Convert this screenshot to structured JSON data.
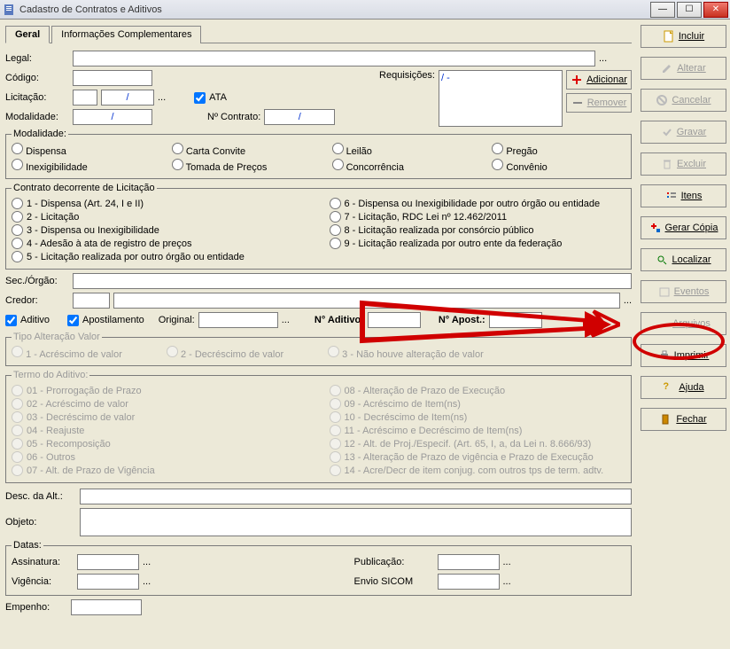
{
  "window": {
    "title": "Cadastro de Contratos e Aditivos"
  },
  "tabs": {
    "geral": "Geral",
    "info": "Informações Complementares"
  },
  "fields": {
    "legal": "Legal:",
    "codigo": "Código:",
    "licitacao": "Licitação:",
    "modalidade_lbl": "Modalidade:",
    "requisicoes": "Requisições:",
    "ata": "ATA",
    "n_contrato": "Nº Contrato:",
    "licitacao_val": "/",
    "modal_val": "/",
    "contrato_val": "/",
    "req_val": "/    -",
    "sec_orgao": "Sec./Órgão:",
    "credor": "Credor:",
    "aditivo": "Aditivo",
    "apostilamento": "Apostilamento",
    "original": "Original:",
    "n_aditivo": "N° Aditivo:",
    "n_apost": "N° Apost.:",
    "desc_alt": "Desc. da Alt.:",
    "objeto": "Objeto:",
    "datas": "Datas:",
    "assinatura": "Assinatura:",
    "vigencia": "Vigência:",
    "publicacao": "Publicação:",
    "envio_sicom": "Envio SICOM",
    "empenho": "Empenho:"
  },
  "modalidade": {
    "legend": "Modalidade:",
    "opts": [
      "Dispensa",
      "Inexigibilidade",
      "Carta Convite",
      "Tomada de Preços",
      "Leilão",
      "Concorrência",
      "Pregão",
      "Convênio"
    ]
  },
  "contrato_lic": {
    "legend": "Contrato decorrente de Licitação",
    "left": [
      "1 - Dispensa  (Art. 24, I e II)",
      "2 - Licitação",
      "3 - Dispensa ou Inexigibilidade",
      "4 - Adesão à ata de registro de preços",
      "5 - Licitação realizada por outro órgão ou entidade"
    ],
    "right": [
      "6 - Dispensa ou Inexigibilidade por outro órgão ou entidade",
      "7 - Licitação, RDC  Lei nº 12.462/2011",
      "8 - Licitação realizada por consórcio público",
      "9 - Licitação realizada por outro ente da federação"
    ]
  },
  "tipo_alt": {
    "legend": "Tipo Alteração Valor",
    "opts": [
      "1 - Acréscimo de valor",
      "2 - Decréscimo de valor",
      "3 - Não houve alteração de valor"
    ]
  },
  "termo": {
    "legend": "Termo do Aditivo:",
    "left": [
      "01 - Prorrogação de Prazo",
      "02 - Acréscimo de valor",
      "03 - Decréscimo de valor",
      "04 - Reajuste",
      "05 - Recomposição",
      "06 - Outros",
      "07 - Alt. de Prazo de Vigência"
    ],
    "right": [
      "08 - Alteração de Prazo de Execução",
      "09 - Acréscimo de Item(ns)",
      "10 - Decréscimo de Item(ns)",
      "11 - Acréscimo e Decréscimo de Item(ns)",
      "12 - Alt. de Proj./Especif. (Art. 65, I, a, da Lei n. 8.666/93)",
      "13 - Alteração de Prazo de vigência e Prazo de Execução",
      "14 - Acre/Decr de item conjug. com outros tps de term. adtv."
    ]
  },
  "buttons": {
    "incluir": "Incluir",
    "alterar": "Alterar",
    "cancelar": "Cancelar",
    "gravar": "Gravar",
    "excluir": "Excluir",
    "itens": "Itens",
    "gerar_copia": "Gerar Cópia",
    "localizar": "Localizar",
    "eventos": "Eventos",
    "arquivos": "Arquivos",
    "imprimir": "Imprimir",
    "ajuda": "Ajuda",
    "fechar": "Fechar",
    "adicionar": "Adicionar",
    "remover": "Remover"
  },
  "ellipsis": "..."
}
